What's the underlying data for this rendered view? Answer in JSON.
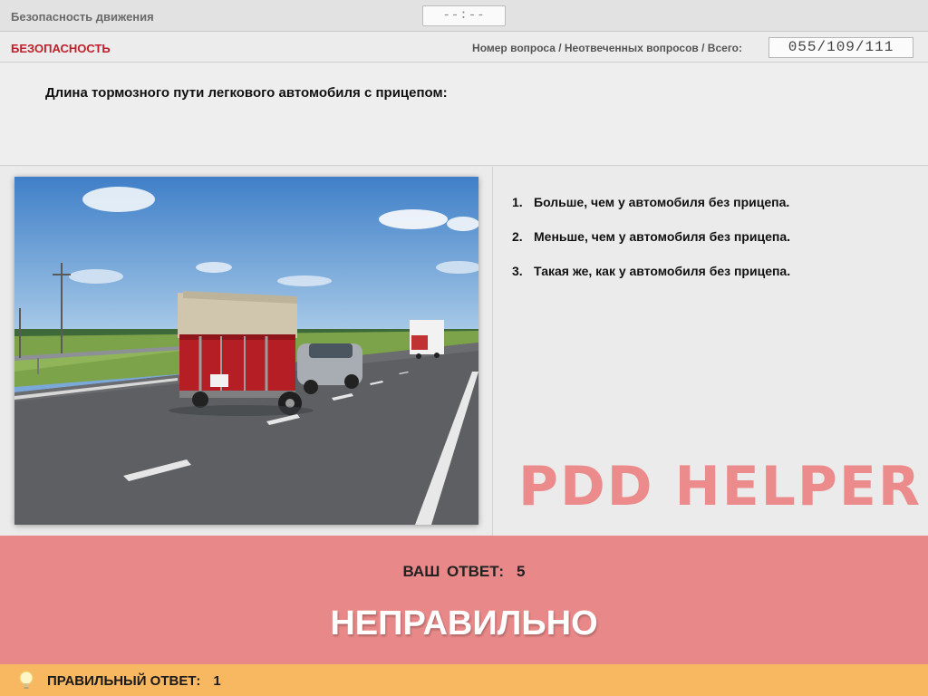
{
  "header": {
    "title": "Безопасность движения",
    "timer": "--:--"
  },
  "infobar": {
    "category": "БЕЗОПАСНОСТЬ",
    "counter_label": "Номер вопроса / Неотвеченных вопросов / Всего:",
    "counter_value": "055/109/111"
  },
  "question": {
    "text": "Длина тормозного пути легкового автомобиля с прицепом:",
    "image_icon": "road-trailer-photo"
  },
  "answers": [
    {
      "num": "1.",
      "text": "Больше, чем у автомобиля без прицепа."
    },
    {
      "num": "2.",
      "text": "Меньше, чем у автомобиля без прицепа."
    },
    {
      "num": "3.",
      "text": "Такая же, как у автомобиля без прицепа."
    }
  ],
  "watermark": "PDD HELPER",
  "result": {
    "your_answer_label": "ВАШ ОТВЕТ:",
    "your_answer_value": "5",
    "verdict": "НЕПРАВИЛЬНО"
  },
  "correct": {
    "icon": "lightbulb-icon",
    "label": "ПРАВИЛЬНЫЙ ОТВЕТ:",
    "value": "1"
  },
  "colors": {
    "category": "#c0202a",
    "result_bg": "#e98888",
    "correct_bg": "#f8b862",
    "watermark": "#ec8b8b"
  }
}
